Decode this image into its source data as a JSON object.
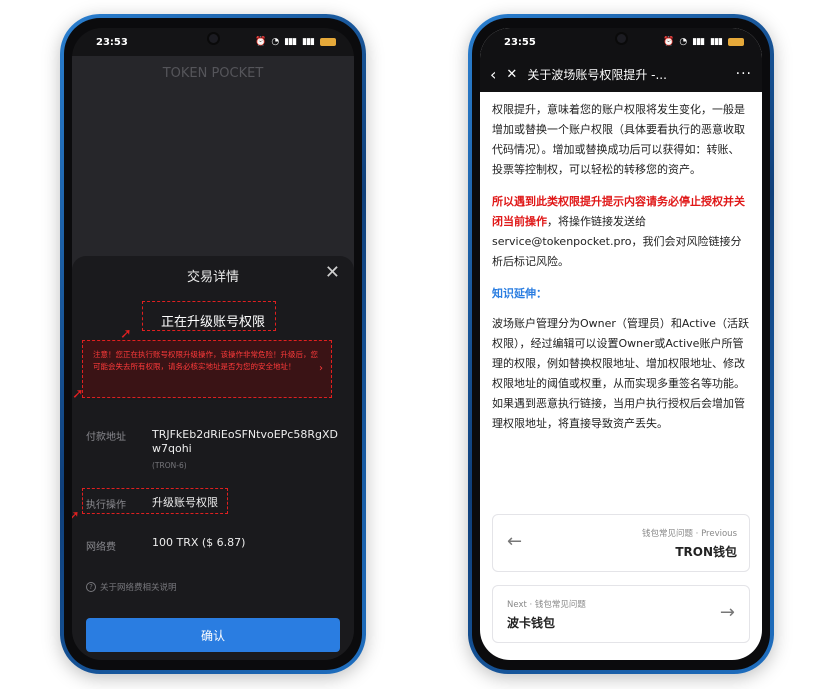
{
  "left": {
    "status_time": "23:53",
    "bg_title": "TOKEN POCKET",
    "bg_line1": "",
    "bg_line2": "",
    "bg_line3": "",
    "sheet_title": "交易详情",
    "operation_title": "正在升级账号权限",
    "warning_text": "注意！您正在执行账号权限升级操作，该操作非常危险！升级后，您可能会失去所有权限，请务必核实地址是否为您的安全地址！",
    "payer_label": "付款地址",
    "payer_address": "TRJFkEb2dRiEoSFNtvoEPc58RgXDw7qohi",
    "payer_network": "(TRON-6)",
    "exec_label": "执行操作",
    "exec_value": "升级账号权限",
    "fee_label": "网络费",
    "fee_value": "100 TRX ($ 6.87)",
    "fee_note": "关于网络费相关说明",
    "confirm_label": "确认"
  },
  "right": {
    "status_time": "23:55",
    "nav_title": "关于波场账号权限提升 -...",
    "para1": "权限提升，意味着您的账户权限将发生变化，一般是增加或替换一个账户权限（具体要看执行的恶意收取代码情况）。增加或替换成功后可以获得如：转账、投票等控制权，可以轻松的转移您的资产。",
    "para2_red": "所以遇到此类权限提升提示内容请务必停止授权并关闭当前操作",
    "para2_rest": "，将操作链接发送给service@tokenpocket.pro，我们会对风险链接分析后标记风险。",
    "section_heading": "知识延伸：",
    "para3": "波场账户管理分为Owner（管理员）和Active（活跃权限），经过编辑可以设置Owner或Active账户所管理的权限，例如替换权限地址、增加权限地址、修改权限地址的阈值或权重，从而实现多重签名等功能。如果遇到恶意执行链接，当用户执行授权后会增加管理权限地址，将直接导致资产丢失。",
    "prev_sub": "钱包常见问题 · Previous",
    "prev_title": "TRON钱包",
    "next_sub": "Next · 钱包常见问题",
    "next_title": "波卡钱包"
  },
  "icons": {
    "close": "close-icon",
    "back": "back-arrow-icon",
    "more": "more-icon",
    "help": "help-circle-icon",
    "arrow_left": "arrow-left-icon",
    "arrow_right": "arrow-right-icon"
  },
  "colors": {
    "accent": "#2a7de1",
    "warning": "#e02020"
  }
}
